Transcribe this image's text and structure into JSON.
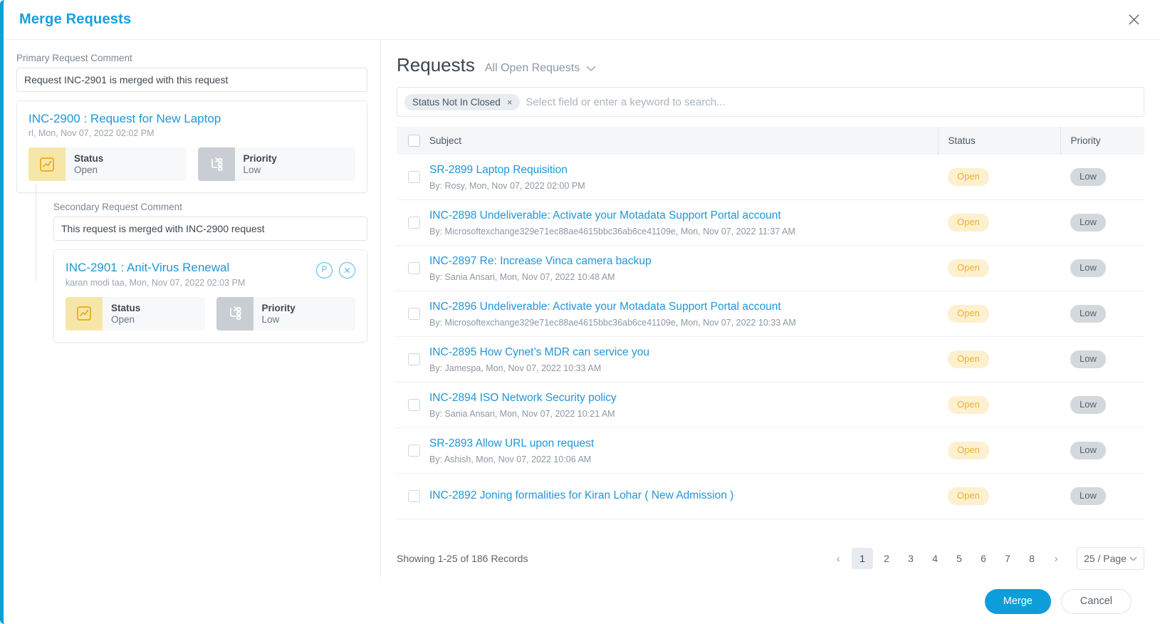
{
  "header": {
    "title": "Merge Requests",
    "close_icon": "close-icon"
  },
  "left": {
    "primary_comment_label": "Primary Request Comment",
    "primary_comment_value": "Request INC-2901 is merged with this request",
    "secondary_comment_label": "Secondary Request Comment",
    "secondary_comment_value": "This request is merged with INC-2900 request",
    "primary_card": {
      "title": "INC-2900 : Request for New Laptop",
      "meta": "rl, Mon, Nov 07, 2022 02:02 PM",
      "status_label": "Status",
      "status_value": "Open",
      "priority_label": "Priority",
      "priority_value": "Low"
    },
    "secondary_card": {
      "title": "INC-2901 : Anit-Virus Renewal",
      "meta": "karan modi taa, Mon, Nov 07, 2022 02:03 PM",
      "status_label": "Status",
      "status_value": "Open",
      "priority_label": "Priority",
      "priority_value": "Low",
      "primary_action_label": "P",
      "remove_action_label": "×"
    }
  },
  "right": {
    "title": "Requests",
    "view_filter": "All Open Requests",
    "search": {
      "chip_label": "Status Not In Closed",
      "chip_remove": "×",
      "placeholder": "Select field or enter a keyword to search..."
    },
    "columns": {
      "subject": "Subject",
      "status": "Status",
      "priority": "Priority"
    },
    "rows": [
      {
        "subject": "SR-2899 Laptop Requisition",
        "by": "By: Rosy, Mon, Nov 07, 2022 02:00 PM",
        "status": "Open",
        "priority": "Low"
      },
      {
        "subject": "INC-2898 Undeliverable: Activate your Motadata Support Portal account",
        "by": "By: Microsoftexchange329e71ec88ae4615bbc36ab6ce41109e, Mon, Nov 07, 2022 11:37 AM",
        "status": "Open",
        "priority": "Low"
      },
      {
        "subject": "INC-2897 Re: Increase Vinca camera backup",
        "by": "By: Sania Ansari, Mon, Nov 07, 2022 10:48 AM",
        "status": "Open",
        "priority": "Low"
      },
      {
        "subject": "INC-2896 Undeliverable: Activate your Motadata Support Portal account",
        "by": "By: Microsoftexchange329e71ec88ae4615bbc36ab6ce41109e, Mon, Nov 07, 2022 10:33 AM",
        "status": "Open",
        "priority": "Low"
      },
      {
        "subject": "INC-2895 How Cynet’s MDR can service you",
        "by": "By: Jamespa, Mon, Nov 07, 2022 10:33 AM",
        "status": "Open",
        "priority": "Low"
      },
      {
        "subject": "INC-2894 ISO Network Security policy",
        "by": "By: Sania Ansari, Mon, Nov 07, 2022 10:21 AM",
        "status": "Open",
        "priority": "Low"
      },
      {
        "subject": "SR-2893 Allow URL upon request",
        "by": "By: Ashish, Mon, Nov 07, 2022 10:06 AM",
        "status": "Open",
        "priority": "Low"
      },
      {
        "subject": "INC-2892 Joning formalities for Kiran Lohar ( New Admission )",
        "by": "",
        "status": "Open",
        "priority": "Low"
      }
    ],
    "pagination": {
      "showing": "Showing 1-25 of 186 Records",
      "prev": "‹",
      "next": "›",
      "pages": [
        "1",
        "2",
        "3",
        "4",
        "5",
        "6",
        "7",
        "8"
      ],
      "active_page": "1",
      "page_size": "25 / Page"
    }
  },
  "footer": {
    "merge_label": "Merge",
    "cancel_label": "Cancel"
  },
  "colors": {
    "accent": "#0d9ddb",
    "link": "#2196d8",
    "status_badge_bg": "#fdf0ce",
    "status_badge_text": "#efb12b",
    "priority_badge_bg": "#d3d8dd",
    "priority_badge_text": "#56606b",
    "status_icon_bg": "#f6e7a8",
    "priority_icon_bg": "#c9ced4"
  }
}
